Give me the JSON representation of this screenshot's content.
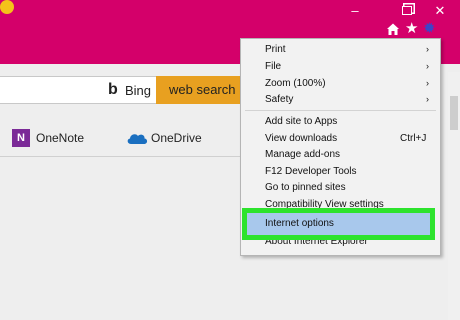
{
  "window": {
    "min_glyph": "–",
    "close_glyph": "✕"
  },
  "toolbar": {
    "home_icon": "home-icon",
    "star_icon": "star-icon",
    "gear_icon": "gear-icon",
    "smile_icon": "smile-icon"
  },
  "search": {
    "bing_glyph": "b",
    "bing_label": "Bing",
    "button_label": "web search"
  },
  "favorites": [
    {
      "label": "OneNote",
      "icon_text": "N"
    },
    {
      "label": "OneDrive"
    }
  ],
  "menu": {
    "items": [
      {
        "label": "Print",
        "arrow": "›"
      },
      {
        "label": "File",
        "arrow": "›"
      },
      {
        "label": "Zoom (100%)",
        "arrow": "›"
      },
      {
        "label": "Safety",
        "arrow": "›"
      },
      {
        "label": "Add site to Apps"
      },
      {
        "label": "View downloads",
        "shortcut": "Ctrl+J"
      },
      {
        "label": "Manage add-ons"
      },
      {
        "label": "F12 Developer Tools"
      },
      {
        "label": "Go to pinned sites"
      },
      {
        "label": "Compatibility View settings"
      },
      {
        "label": "Internet options"
      },
      {
        "label": "About Internet Explorer"
      }
    ]
  },
  "colors": {
    "titlebar": "#d4006a",
    "search_button": "#e8a020",
    "highlight_border": "#2de32d",
    "highlight_fill": "#a8c8ec"
  }
}
